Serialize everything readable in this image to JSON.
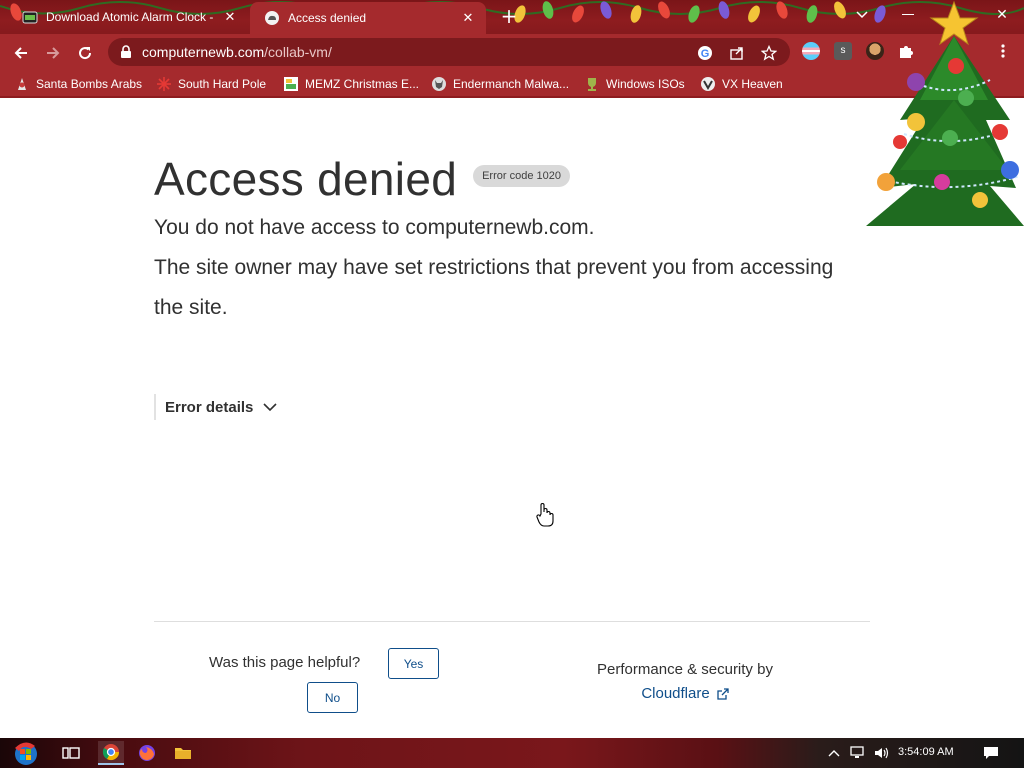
{
  "tabs": [
    {
      "title": "Download Atomic Alarm Clock -",
      "active": false
    },
    {
      "title": "Access denied",
      "active": true
    }
  ],
  "address_bar": {
    "domain": "computernewb.com",
    "path": "/collab-vm/"
  },
  "bookmarks": [
    {
      "label": "Santa Bombs Arabs",
      "icon": "santa-icon"
    },
    {
      "label": "South Hard Pole",
      "icon": "snowflake-icon"
    },
    {
      "label": "MEMZ Christmas E...",
      "icon": "memz-icon"
    },
    {
      "label": "Endermanch Malwa...",
      "icon": "wolf-icon"
    },
    {
      "label": "Windows ISOs",
      "icon": "trophy-icon"
    },
    {
      "label": "VX Heaven",
      "icon": "vx-icon"
    }
  ],
  "page": {
    "heading": "Access denied",
    "error_code": "Error code 1020",
    "message_line1": "You do not have access to computernewb.com.",
    "message_line2": "The site owner may have set restrictions that prevent you from accessing the site.",
    "error_details": "Error details",
    "helpful_question": "Was this page helpful?",
    "yes_label": "Yes",
    "no_label": "No",
    "performance_text": "Performance & security by",
    "cloudflare_link": "Cloudflare"
  },
  "taskbar": {
    "clock": "3:54:09 AM"
  },
  "colors": {
    "theme_red": "#a52a2d",
    "tab_strip": "#8e1c1f",
    "link_blue": "#0f4e8a",
    "text_dark": "#313131"
  }
}
